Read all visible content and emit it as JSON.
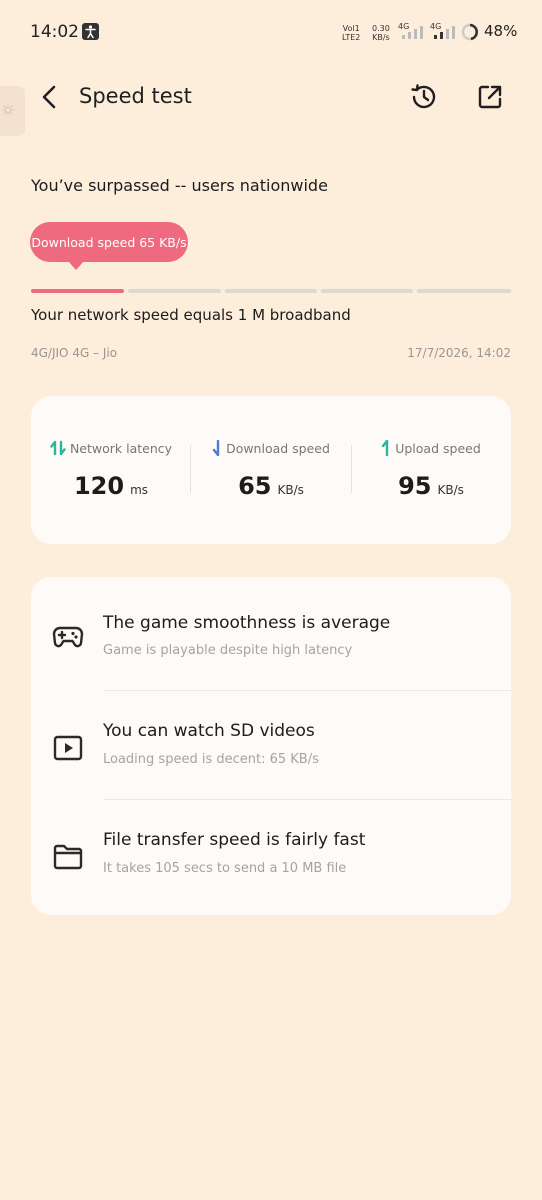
{
  "status_bar": {
    "time": "14:02",
    "volte_top": "Vol1",
    "volte_bottom": "LTE2",
    "speed_top": "0.30",
    "speed_bottom": "KB/s",
    "net1": "4G",
    "net2": "4G",
    "battery": "48%"
  },
  "header": {
    "title": "Speed test",
    "back_icon": "back-arrow-icon",
    "history_icon": "history-clock-icon",
    "share_icon": "open-external-icon"
  },
  "summary": {
    "surpassed_text": "You’ve surpassed -- users nationwide",
    "bubble_text": "Download speed 65 KB/s",
    "progress_active_segment": 1,
    "progress_segments": 5,
    "equals_text": "Your network speed equals 1 M  broadband",
    "network_info": "4G/JIO 4G – Jio",
    "timestamp": "17/7/2026, 14:02"
  },
  "stats": [
    {
      "label": "Network latency",
      "value": "120",
      "unit": "ms",
      "icon": "latency-arrows-icon"
    },
    {
      "label": "Download speed",
      "value": "65",
      "unit": "KB/s",
      "icon": "download-arrow-icon"
    },
    {
      "label": "Upload speed",
      "value": "95",
      "unit": "KB/s",
      "icon": "upload-arrow-icon"
    }
  ],
  "results": [
    {
      "title": "The game smoothness is average",
      "subtitle": "Game is playable despite high latency",
      "icon": "gamepad-icon"
    },
    {
      "title": "You can watch SD videos",
      "subtitle": "Loading speed is decent: 65 KB/s",
      "icon": "video-play-icon"
    },
    {
      "title": "File transfer speed is fairly fast",
      "subtitle": "It takes 105 secs to send a 10 MB file",
      "icon": "folder-icon"
    }
  ],
  "colors": {
    "background": "#FDEEDC",
    "accent": "#EF6A7F",
    "latency_icon": "#2BB59A",
    "download_icon": "#4A7FD0",
    "upload_icon": "#2BB59A"
  }
}
